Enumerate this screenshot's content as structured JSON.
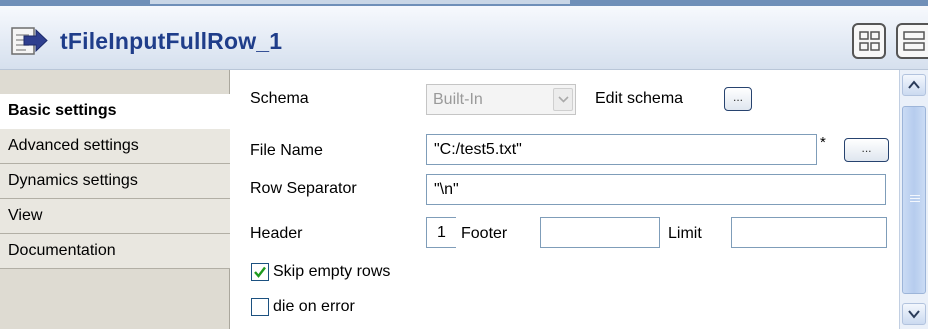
{
  "header": {
    "title": "tFileInputFullRow_1",
    "component_icon": "file-input-arrow-icon",
    "view_buttons": [
      "grid-view-icon",
      "list-view-icon"
    ]
  },
  "sidebar": {
    "tabs": [
      {
        "label": "Basic settings",
        "active": true
      },
      {
        "label": "Advanced settings",
        "active": false
      },
      {
        "label": "Dynamics settings",
        "active": false
      },
      {
        "label": "View",
        "active": false
      },
      {
        "label": "Documentation",
        "active": false
      }
    ]
  },
  "form": {
    "schema": {
      "label": "Schema",
      "value": "Built-In",
      "edit_label": "Edit schema",
      "button": "..."
    },
    "file_name": {
      "label": "File Name",
      "value": "\"C:/test5.txt\"",
      "required_mark": "*",
      "button": "..."
    },
    "row_separator": {
      "label": "Row Separator",
      "value": "\"\\n\""
    },
    "header": {
      "label": "Header",
      "value": "1"
    },
    "footer": {
      "label": "Footer",
      "value": ""
    },
    "limit": {
      "label": "Limit",
      "value": ""
    },
    "skip_empty_rows": {
      "label": "Skip empty rows",
      "checked": true
    },
    "die_on_error": {
      "label": "die on error",
      "checked": false
    }
  },
  "colors": {
    "title": "#1f3d8a",
    "check": "#1f9a1f",
    "field_border": "#7f9db9",
    "sidebar_bg": "#dedbd2"
  }
}
